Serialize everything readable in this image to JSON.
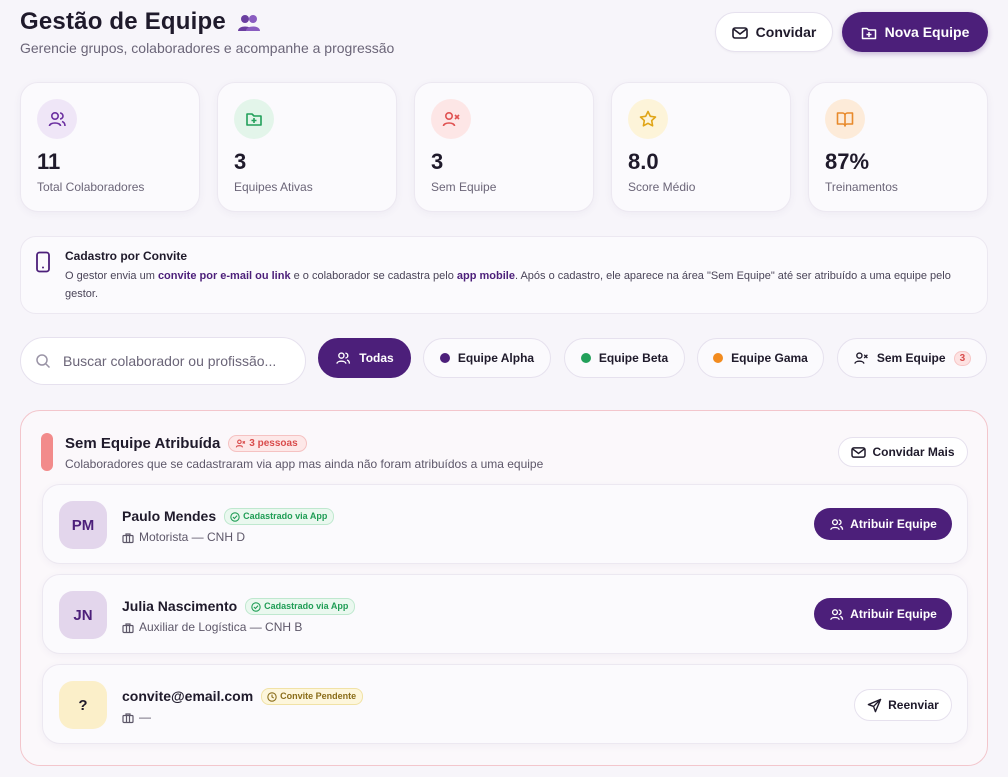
{
  "header": {
    "title": "Gestão de Equipe",
    "subtitle": "Gerencie grupos, colaboradores e acompanhe a progressão",
    "invite_label": "Convidar",
    "new_team_label": "Nova Equipe"
  },
  "stats": [
    {
      "icon": "users-icon",
      "value": "11",
      "label": "Total Colaboradores",
      "color": "#6b2fa0",
      "bg": "#efe6f7"
    },
    {
      "icon": "folder-plus-icon",
      "value": "3",
      "label": "Equipes Ativas",
      "color": "#22a05a",
      "bg": "#e3f5ea"
    },
    {
      "icon": "user-x-icon",
      "value": "3",
      "label": "Sem Equipe",
      "color": "#e05252",
      "bg": "#fde6e6"
    },
    {
      "icon": "star-icon",
      "value": "8.0",
      "label": "Score Médio",
      "color": "#e0a516",
      "bg": "#fdf4d9"
    },
    {
      "icon": "book-icon",
      "value": "87%",
      "label": "Treinamentos",
      "color": "#e8892b",
      "bg": "#fdebd9"
    }
  ],
  "info": {
    "title": "Cadastro por Convite",
    "text_1": "O gestor envia um ",
    "bold_1": "convite por e-mail ou link",
    "text_2": " e o colaborador se cadastra pelo ",
    "bold_2": "app mobile",
    "text_3": ". Após o cadastro, ele aparece na área \"Sem Equipe\" até ser atribuído a uma equipe pelo gestor."
  },
  "search": {
    "placeholder": "Buscar colaborador ou profissão..."
  },
  "filters": [
    {
      "label": "Todas",
      "active": true
    },
    {
      "label": "Equipe Alpha",
      "dot": "#4c1f7a"
    },
    {
      "label": "Equipe Beta",
      "dot": "#22a05a"
    },
    {
      "label": "Equipe Gama",
      "dot": "#f28b1f"
    },
    {
      "label": "Sem Equipe",
      "count": "3"
    }
  ],
  "unassigned": {
    "title": "Sem Equipe Atribuída",
    "badge": "3 pessoas",
    "subtitle": "Colaboradores que se cadastraram via app mas ainda não foram atribuídos a uma equipe",
    "invite_more_label": "Convidar Mais",
    "members": [
      {
        "initials": "PM",
        "name": "Paulo Mendes",
        "tag": "Cadastrado via App",
        "role": "Motorista — CNH D",
        "action": "Atribuir Equipe"
      },
      {
        "initials": "JN",
        "name": "Julia Nascimento",
        "tag": "Cadastrado via App",
        "role": "Auxiliar de Logística — CNH B",
        "action": "Atribuir Equipe"
      },
      {
        "initials": "?",
        "name": "convite@email.com",
        "tag": "Convite Pendente",
        "role": "—",
        "action": "Reenviar"
      }
    ]
  }
}
